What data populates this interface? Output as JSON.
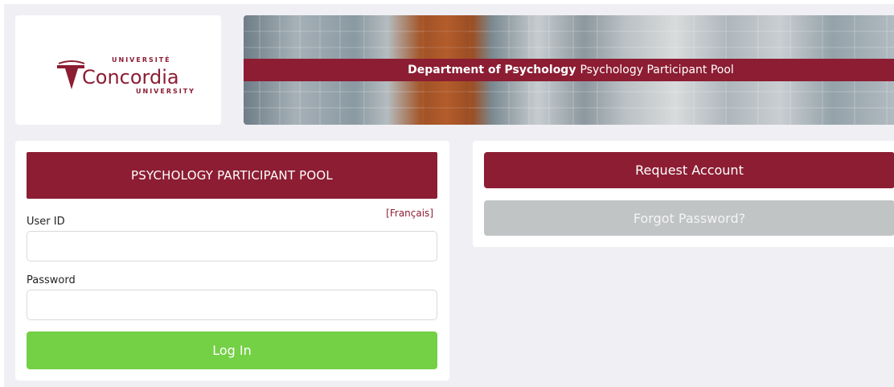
{
  "logo": {
    "top_text": "UNIVERSITÉ",
    "name": "Concordia",
    "bottom_text": "UNIVERSITY"
  },
  "banner": {
    "department": "Department of Psychology",
    "pool_name": "Psychology Participant Pool"
  },
  "login": {
    "header": "PSYCHOLOGY PARTICIPANT POOL",
    "language_link": "[Français]",
    "userid_label": "User ID",
    "userid_value": "",
    "password_label": "Password",
    "password_value": "",
    "login_button": "Log In"
  },
  "actions": {
    "request_account": "Request Account",
    "forgot_password": "Forgot Password?"
  },
  "colors": {
    "brand": "#8c1d33",
    "login_green": "#74d045",
    "disabled_gray": "#c1c4c5",
    "background": "#f0eff4"
  }
}
